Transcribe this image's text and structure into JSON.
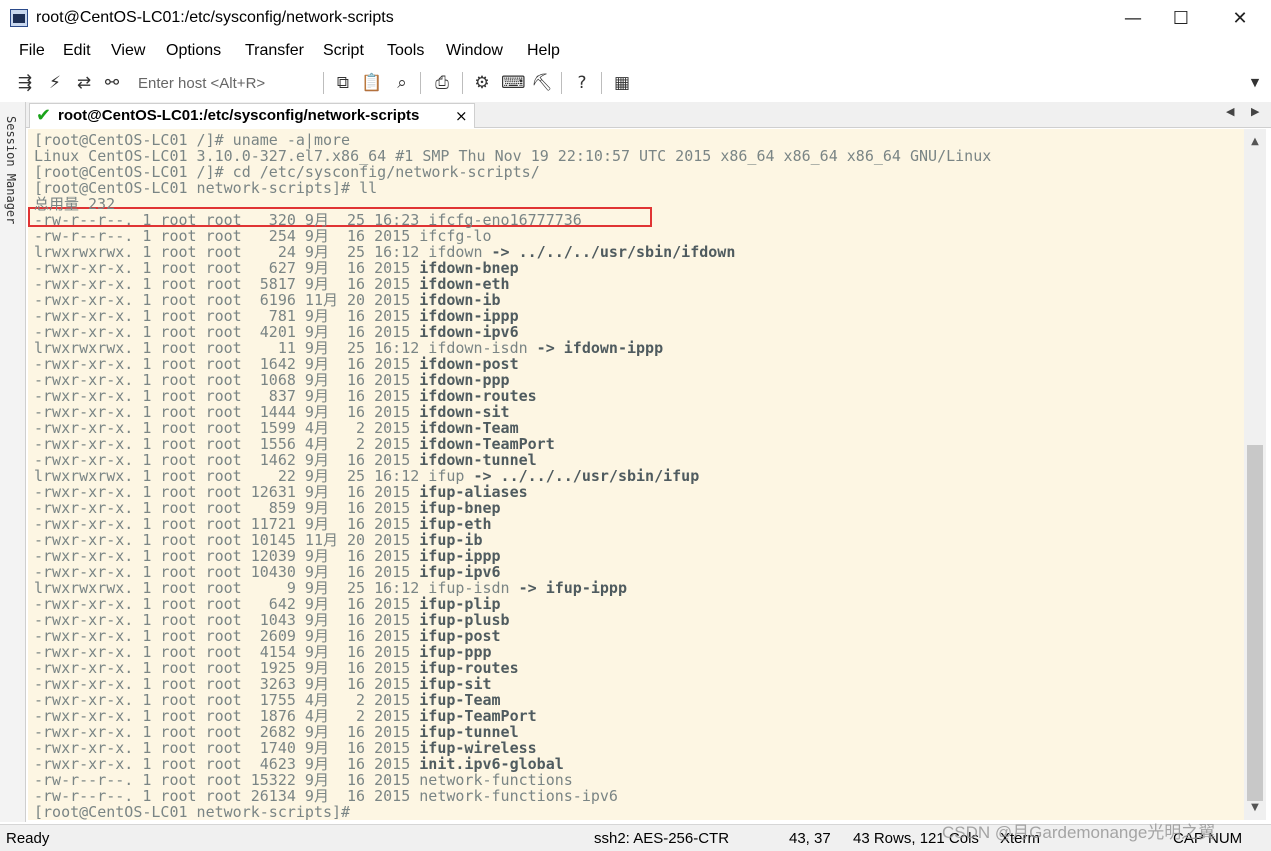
{
  "window": {
    "title": "root@CentOS-LC01:/etc/sysconfig/network-scripts",
    "controls": [
      "—",
      "☐",
      "✕"
    ]
  },
  "menu": [
    "File",
    "Edit",
    "View",
    "Options",
    "Transfer",
    "Script",
    "Tools",
    "Window",
    "Help"
  ],
  "toolbar": {
    "host_placeholder": "Enter host <Alt+R>",
    "icons": [
      "connect-icon",
      "quick-connect-icon",
      "reconnect-icon",
      "disconnect-icon",
      "copy-icon",
      "paste-icon",
      "find-icon",
      "print-icon",
      "settings-icon",
      "keymap-icon",
      "sftp-icon",
      "help-icon",
      "keyboard-icon"
    ]
  },
  "session_manager": {
    "label": "Session Manager"
  },
  "tab": {
    "title": "root@CentOS-LC01:/etc/sysconfig/network-scripts",
    "close": "×"
  },
  "terminal": {
    "lines": [
      "[root@CentOS-LC01 /]# uname -a|more",
      "Linux CentOS-LC01 3.10.0-327.el7.x86_64 #1 SMP Thu Nov 19 22:10:57 UTC 2015 x86_64 x86_64 x86_64 GNU/Linux",
      "[root@CentOS-LC01 /]# cd /etc/sysconfig/network-scripts/",
      "[root@CentOS-LC01 network-scripts]# ll",
      "总用量 232"
    ],
    "listing": [
      {
        "meta": "-rw-r--r--. 1 root root   320 9月  25 16:23 ",
        "name": "ifcfg-eno16777736",
        "bold": false,
        "target": ""
      },
      {
        "meta": "-rw-r--r--. 1 root root   254 9月  16 2015 ",
        "name": "ifcfg-lo",
        "bold": false,
        "target": ""
      },
      {
        "meta": "lrwxrwxrwx. 1 root root    24 9月  25 16:12 ",
        "name": "ifdown",
        "bold": false,
        "target": " -> ../../../usr/sbin/ifdown"
      },
      {
        "meta": "-rwxr-xr-x. 1 root root   627 9月  16 2015 ",
        "name": "ifdown-bnep",
        "bold": true,
        "target": ""
      },
      {
        "meta": "-rwxr-xr-x. 1 root root  5817 9月  16 2015 ",
        "name": "ifdown-eth",
        "bold": true,
        "target": ""
      },
      {
        "meta": "-rwxr-xr-x. 1 root root  6196 11月 20 2015 ",
        "name": "ifdown-ib",
        "bold": true,
        "target": ""
      },
      {
        "meta": "-rwxr-xr-x. 1 root root   781 9月  16 2015 ",
        "name": "ifdown-ippp",
        "bold": true,
        "target": ""
      },
      {
        "meta": "-rwxr-xr-x. 1 root root  4201 9月  16 2015 ",
        "name": "ifdown-ipv6",
        "bold": true,
        "target": ""
      },
      {
        "meta": "lrwxrwxrwx. 1 root root    11 9月  25 16:12 ",
        "name": "ifdown-isdn",
        "bold": false,
        "target": " -> ifdown-ippp"
      },
      {
        "meta": "-rwxr-xr-x. 1 root root  1642 9月  16 2015 ",
        "name": "ifdown-post",
        "bold": true,
        "target": ""
      },
      {
        "meta": "-rwxr-xr-x. 1 root root  1068 9月  16 2015 ",
        "name": "ifdown-ppp",
        "bold": true,
        "target": ""
      },
      {
        "meta": "-rwxr-xr-x. 1 root root   837 9月  16 2015 ",
        "name": "ifdown-routes",
        "bold": true,
        "target": ""
      },
      {
        "meta": "-rwxr-xr-x. 1 root root  1444 9月  16 2015 ",
        "name": "ifdown-sit",
        "bold": true,
        "target": ""
      },
      {
        "meta": "-rwxr-xr-x. 1 root root  1599 4月   2 2015 ",
        "name": "ifdown-Team",
        "bold": true,
        "target": ""
      },
      {
        "meta": "-rwxr-xr-x. 1 root root  1556 4月   2 2015 ",
        "name": "ifdown-TeamPort",
        "bold": true,
        "target": ""
      },
      {
        "meta": "-rwxr-xr-x. 1 root root  1462 9月  16 2015 ",
        "name": "ifdown-tunnel",
        "bold": true,
        "target": ""
      },
      {
        "meta": "lrwxrwxrwx. 1 root root    22 9月  25 16:12 ",
        "name": "ifup",
        "bold": false,
        "target": " -> ../../../usr/sbin/ifup"
      },
      {
        "meta": "-rwxr-xr-x. 1 root root 12631 9月  16 2015 ",
        "name": "ifup-aliases",
        "bold": true,
        "target": ""
      },
      {
        "meta": "-rwxr-xr-x. 1 root root   859 9月  16 2015 ",
        "name": "ifup-bnep",
        "bold": true,
        "target": ""
      },
      {
        "meta": "-rwxr-xr-x. 1 root root 11721 9月  16 2015 ",
        "name": "ifup-eth",
        "bold": true,
        "target": ""
      },
      {
        "meta": "-rwxr-xr-x. 1 root root 10145 11月 20 2015 ",
        "name": "ifup-ib",
        "bold": true,
        "target": ""
      },
      {
        "meta": "-rwxr-xr-x. 1 root root 12039 9月  16 2015 ",
        "name": "ifup-ippp",
        "bold": true,
        "target": ""
      },
      {
        "meta": "-rwxr-xr-x. 1 root root 10430 9月  16 2015 ",
        "name": "ifup-ipv6",
        "bold": true,
        "target": ""
      },
      {
        "meta": "lrwxrwxrwx. 1 root root     9 9月  25 16:12 ",
        "name": "ifup-isdn",
        "bold": false,
        "target": " -> ifup-ippp"
      },
      {
        "meta": "-rwxr-xr-x. 1 root root   642 9月  16 2015 ",
        "name": "ifup-plip",
        "bold": true,
        "target": ""
      },
      {
        "meta": "-rwxr-xr-x. 1 root root  1043 9月  16 2015 ",
        "name": "ifup-plusb",
        "bold": true,
        "target": ""
      },
      {
        "meta": "-rwxr-xr-x. 1 root root  2609 9月  16 2015 ",
        "name": "ifup-post",
        "bold": true,
        "target": ""
      },
      {
        "meta": "-rwxr-xr-x. 1 root root  4154 9月  16 2015 ",
        "name": "ifup-ppp",
        "bold": true,
        "target": ""
      },
      {
        "meta": "-rwxr-xr-x. 1 root root  1925 9月  16 2015 ",
        "name": "ifup-routes",
        "bold": true,
        "target": ""
      },
      {
        "meta": "-rwxr-xr-x. 1 root root  3263 9月  16 2015 ",
        "name": "ifup-sit",
        "bold": true,
        "target": ""
      },
      {
        "meta": "-rwxr-xr-x. 1 root root  1755 4月   2 2015 ",
        "name": "ifup-Team",
        "bold": true,
        "target": ""
      },
      {
        "meta": "-rwxr-xr-x. 1 root root  1876 4月   2 2015 ",
        "name": "ifup-TeamPort",
        "bold": true,
        "target": ""
      },
      {
        "meta": "-rwxr-xr-x. 1 root root  2682 9月  16 2015 ",
        "name": "ifup-tunnel",
        "bold": true,
        "target": ""
      },
      {
        "meta": "-rwxr-xr-x. 1 root root  1740 9月  16 2015 ",
        "name": "ifup-wireless",
        "bold": true,
        "target": ""
      },
      {
        "meta": "-rwxr-xr-x. 1 root root  4623 9月  16 2015 ",
        "name": "init.ipv6-global",
        "bold": true,
        "target": ""
      },
      {
        "meta": "-rw-r--r--. 1 root root 15322 9月  16 2015 ",
        "name": "network-functions",
        "bold": false,
        "target": ""
      },
      {
        "meta": "-rw-r--r--. 1 root root 26134 9月  16 2015 ",
        "name": "network-functions-ipv6",
        "bold": false,
        "target": ""
      }
    ],
    "prompt": "[root@CentOS-LC01 network-scripts]#"
  },
  "status": {
    "ready": "Ready",
    "cipher": "ssh2: AES-256-CTR",
    "cursor": "43,  37",
    "size": "43 Rows, 121 Cols",
    "term": "Xterm",
    "caps": "CAP",
    "num": "NUM"
  },
  "watermark": "CSDN @月Gardemonange光明之翼"
}
